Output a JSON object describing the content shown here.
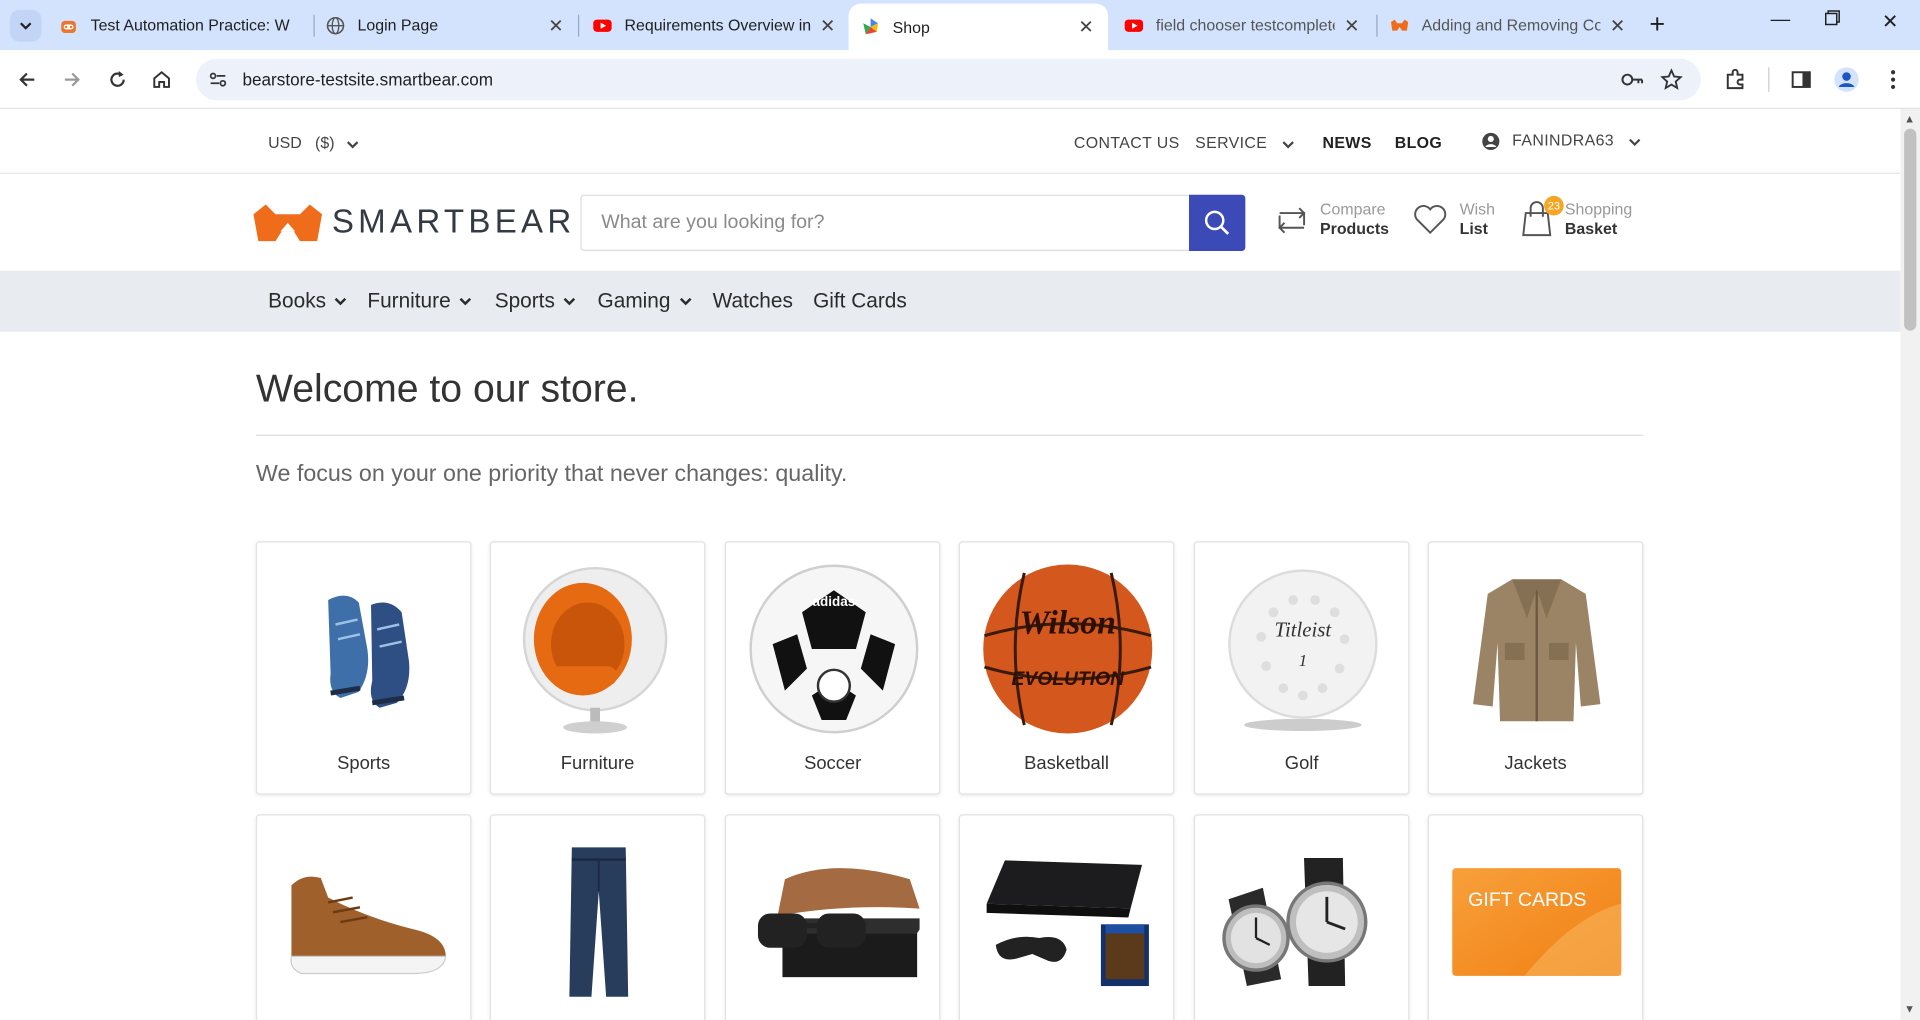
{
  "browser": {
    "tabs": [
      {
        "title": "Test Automation Practice: W",
        "icon": "robot-favicon"
      },
      {
        "title": "Login Page",
        "icon": "globe-favicon"
      },
      {
        "title": "Requirements Overview in",
        "icon": "youtube-favicon"
      },
      {
        "title": "Shop",
        "icon": "shop-favicon"
      },
      {
        "title": "field chooser testcomplete",
        "icon": "youtube-favicon"
      },
      {
        "title": "Adding and Removing Col",
        "icon": "smartbear-favicon"
      }
    ],
    "url": "bearstore-testsite.smartbear.com"
  },
  "topbar": {
    "currency": "USD",
    "currency_symbol": "($)",
    "contact": "CONTACT US",
    "service": "SERVICE",
    "news": "NEWS",
    "blog": "BLOG",
    "user": "FANINDRA63"
  },
  "header": {
    "logo_text": "SMARTBEAR",
    "logo_tm": ".",
    "search_placeholder": "What are you looking for?",
    "compare_l1": "Compare",
    "compare_l2": "Products",
    "wish_l1": "Wish",
    "wish_l2": "List",
    "basket_l1": "Shopping",
    "basket_l2": "Basket",
    "basket_count": "23"
  },
  "nav": {
    "items": [
      {
        "label": "Books",
        "dropdown": true
      },
      {
        "label": "Furniture",
        "dropdown": true
      },
      {
        "label": "Sports",
        "dropdown": true
      },
      {
        "label": "Gaming",
        "dropdown": true
      },
      {
        "label": "Watches",
        "dropdown": false
      },
      {
        "label": "Gift Cards",
        "dropdown": false
      }
    ]
  },
  "main": {
    "heading": "Welcome to our store.",
    "tagline": "We focus on your one priority that never changes: quality.",
    "categories": [
      {
        "label": "Sports",
        "icon": "sneakers-image"
      },
      {
        "label": "Furniture",
        "icon": "ball-chair-image"
      },
      {
        "label": "Soccer",
        "icon": "soccer-ball-image"
      },
      {
        "label": "Basketball",
        "icon": "basketball-image"
      },
      {
        "label": "Golf",
        "icon": "golf-ball-image"
      },
      {
        "label": "Jackets",
        "icon": "jacket-image"
      }
    ],
    "second_row": [
      {
        "icon": "brown-sneaker-image"
      },
      {
        "icon": "jeans-image"
      },
      {
        "icon": "sunglasses-image"
      },
      {
        "icon": "playstation-image"
      },
      {
        "icon": "watches-image"
      },
      {
        "icon": "gift-card-image",
        "text": "GIFT CARDS"
      }
    ],
    "basketball_brand": "Wilson",
    "basketball_model": "EVOLUTION",
    "soccer_brand": "adidas",
    "golf_brand": "Titleist",
    "golf_number": "1"
  },
  "colors": {
    "brand_orange": "#ef6c1a",
    "search_button": "#3c4ab7",
    "nav_bg": "#e8ebef",
    "tabbar_bg": "#d3e3fd"
  }
}
